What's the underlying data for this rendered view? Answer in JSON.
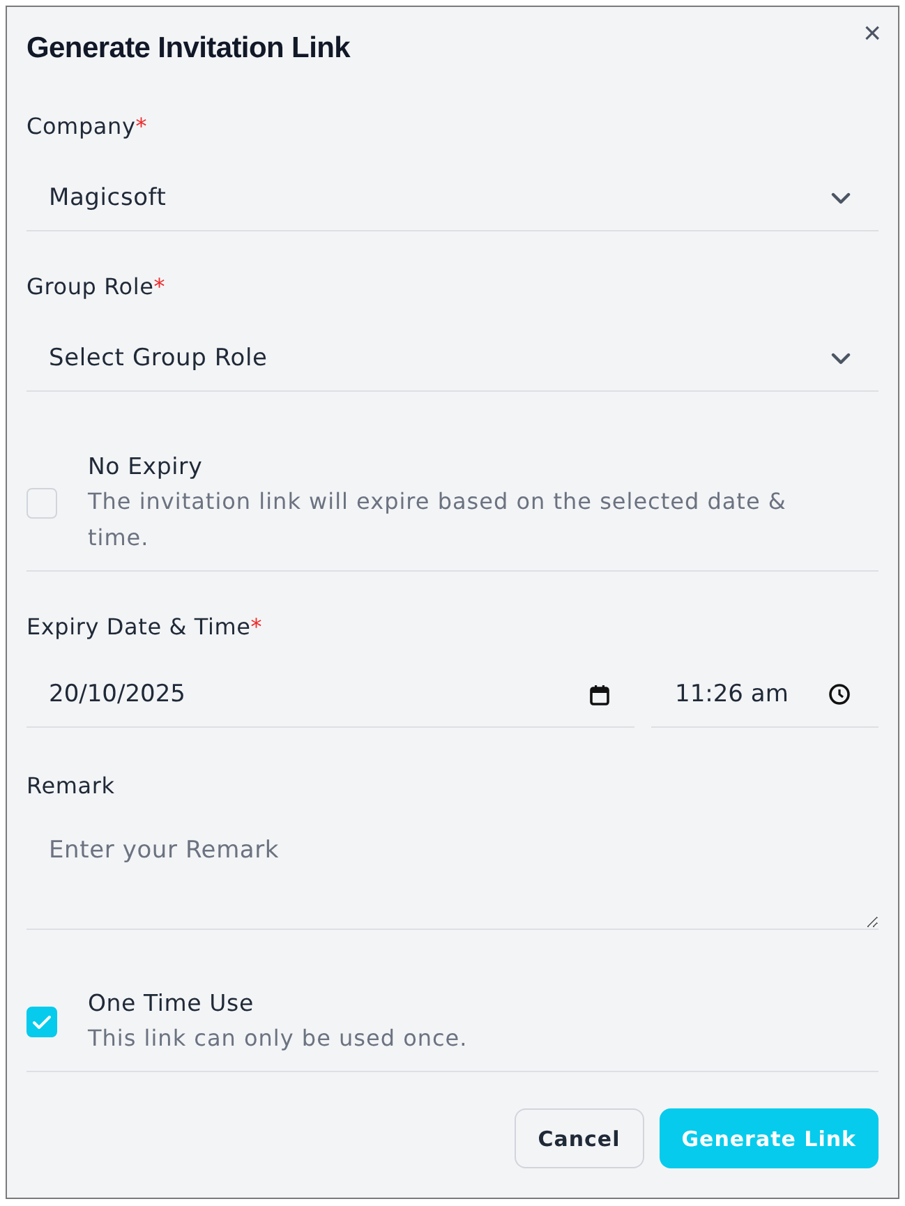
{
  "dialog": {
    "title": "Generate Invitation Link",
    "close": "×"
  },
  "fields": [
    {
      "kind": "select",
      "label": "Company",
      "required_mark": "*",
      "value": "Magicsoft"
    },
    {
      "kind": "select",
      "label": "Group Role",
      "required_mark": "*",
      "placeholder": "Select Group Role"
    },
    {
      "kind": "checkbox",
      "label": "No Expiry",
      "description": "The invitation link will expire based on the selected date & time.",
      "checked": false
    },
    {
      "kind": "datetime",
      "label": "Expiry Date & Time",
      "required_mark": "*",
      "date": "20/10/2025",
      "time": "11:26 am"
    },
    {
      "kind": "textarea",
      "label": "Remark",
      "placeholder": "Enter your Remark"
    },
    {
      "kind": "checkbox",
      "label": "One Time Use",
      "description": "This link can only be used once.",
      "checked": true
    }
  ],
  "buttons": [
    {
      "label": "Cancel",
      "kind": "secondary"
    },
    {
      "label": "Generate Link",
      "kind": "primary"
    }
  ]
}
